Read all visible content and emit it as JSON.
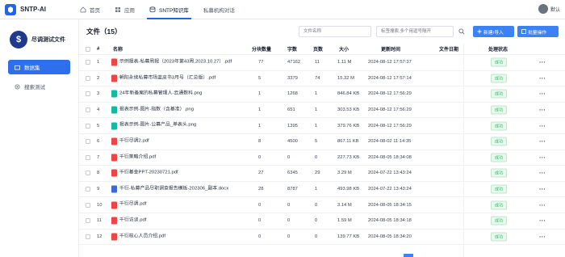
{
  "app": {
    "name": "SNTP-AI"
  },
  "nav": [
    {
      "label": "首页"
    },
    {
      "label": "应用"
    },
    {
      "label": "SNTP知识库"
    },
    {
      "label": "私募机构对话"
    }
  ],
  "user": {
    "name": "默认"
  },
  "sidebar": {
    "kb_name": "尽调测试文件",
    "items": [
      {
        "label": "数据集"
      },
      {
        "label": "搜索测试"
      }
    ]
  },
  "main": {
    "title": "文件（15）",
    "name_search_placeholder": "文件名称",
    "tag_search_placeholder": "标签搜索,多个用逗号隔开",
    "import_button": "新建/导入",
    "batch_button": "批量操作"
  },
  "table": {
    "headers": {
      "index": "#",
      "name": "名称",
      "chunks": "分块数量",
      "chars": "字数",
      "pages": "页数",
      "size": "大小",
      "updated": "更新时间",
      "file_date": "文件日期",
      "status": "处理状态"
    },
    "rows": [
      {
        "index": "1",
        "type": "pdf",
        "name": "示例报表-私募周报（2023年第43周,2023.10.27）.pdf",
        "chunks": "77",
        "chars": "47162",
        "pages": "11",
        "size": "1.11 M",
        "updated": "2024-08-12 17:57:37",
        "status": "成功"
      },
      {
        "index": "2",
        "type": "pdf",
        "name": "朝阳永续私募市场蓝皮书3月号（汇总版）.pdf",
        "chunks": "5",
        "chars": "3379",
        "pages": "74",
        "size": "15.32 M",
        "updated": "2024-08-12 17:57:14",
        "status": "成功"
      },
      {
        "index": "3",
        "type": "png",
        "name": "24年新备案的私募管理人-云通数科.png",
        "chunks": "1",
        "chars": "1268",
        "pages": "1",
        "size": "846.84 KB",
        "updated": "2024-08-12 17:56:29",
        "status": "成功"
      },
      {
        "index": "4",
        "type": "png",
        "name": "报表示例-图片-指数（含基准）.png",
        "chunks": "1",
        "chars": "651",
        "pages": "1",
        "size": "303.53 KB",
        "updated": "2024-08-12 17:56:29",
        "status": "成功"
      },
      {
        "index": "5",
        "type": "png",
        "name": "报表示例-图片-公募产品_单表头.png",
        "chunks": "1",
        "chars": "1395",
        "pages": "1",
        "size": "379.76 KB",
        "updated": "2024-08-12 17:56:29",
        "status": "成功"
      },
      {
        "index": "6",
        "type": "pdf",
        "name": "千衍尽调2.pdf",
        "chunks": "8",
        "chars": "4500",
        "pages": "5",
        "size": "867.11 KB",
        "updated": "2024-08-02 11:14:35",
        "status": "成功"
      },
      {
        "index": "7",
        "type": "pdf",
        "name": "千衍策略介绍.pdf",
        "chunks": "0",
        "chars": "0",
        "pages": "0",
        "size": "227.73 KB",
        "updated": "2024-08-05 18:34:08",
        "status": "成功"
      },
      {
        "index": "8",
        "type": "pdf",
        "name": "千衍基金PPT-20230721.pdf",
        "chunks": "27",
        "chars": "6345",
        "pages": "29",
        "size": "3.29 M",
        "updated": "2024-07-22 13:43:24",
        "status": "成功"
      },
      {
        "index": "9",
        "type": "docx",
        "name": "千衍-私募产品尽职调查报告模板-202306_副本.docx",
        "chunks": "28",
        "chars": "8787",
        "pages": "1",
        "size": "493.98 KB",
        "updated": "2024-07-22 13:43:24",
        "status": "成功"
      },
      {
        "index": "10",
        "type": "pdf",
        "name": "千衍尽调.pdf",
        "chunks": "0",
        "chars": "0",
        "pages": "0",
        "size": "3.14 M",
        "updated": "2024-08-05 18:34:15",
        "status": "成功"
      },
      {
        "index": "11",
        "type": "pdf",
        "name": "千衍访谈.pdf",
        "chunks": "0",
        "chars": "0",
        "pages": "0",
        "size": "1.59 M",
        "updated": "2024-08-05 18:34:18",
        "status": "成功"
      },
      {
        "index": "12",
        "type": "pdf",
        "name": "千衍核心人员介绍.pdf",
        "chunks": "0",
        "chars": "0",
        "pages": "0",
        "size": "139.77 KB",
        "updated": "2024-08-05 18:34:20",
        "status": "成功"
      }
    ]
  },
  "colors": {
    "accent": "#2f6fed",
    "success": "#22c55e",
    "pdf": "#ef4444",
    "png": "#14b8a6",
    "docx": "#3b6ad6"
  },
  "icons": {
    "home": "home-icon",
    "apps": "grid-icon",
    "kb": "database-icon",
    "chat": "chat-icon",
    "dataset": "folder-icon",
    "search": "search-icon"
  }
}
